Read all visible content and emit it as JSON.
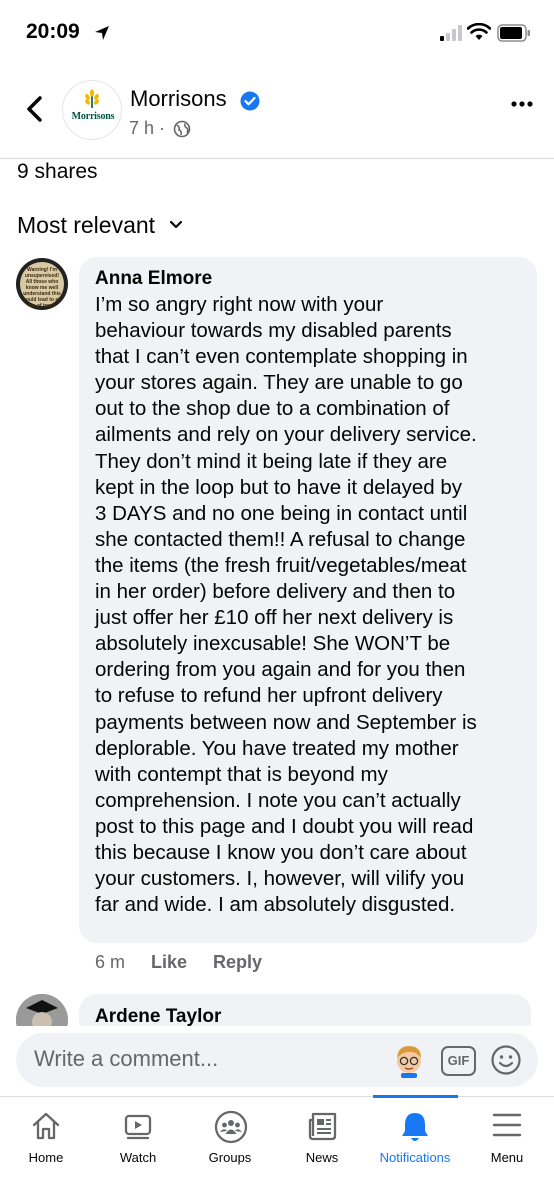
{
  "status_bar": {
    "time": "20:09"
  },
  "header": {
    "page_name": "Morrisons",
    "post_time": "7 h ·",
    "logo_text": "Morrisons"
  },
  "post": {
    "shares": "9 shares"
  },
  "sort": {
    "label": "Most relevant"
  },
  "comments": [
    {
      "author": "Anna Elmore",
      "avatar_text": "Warning! I'm unsupervised! All those who know me well understand this could lead to all kinds of trouble!",
      "lines": [
        "I’m so angry right now with your",
        "behaviour towards my disabled parents",
        "that I can’t even contemplate shopping in",
        "your stores again. They are unable to go",
        "out to the shop due to a combination of",
        "ailments and rely on your delivery service.",
        "They don’t mind it being late if they are",
        "kept in the loop but to have it delayed by",
        "3 DAYS and no one being in contact until",
        "she contacted them!! A refusal to change",
        "the items (the fresh fruit/vegetables/meat",
        "in her order) before delivery and then to",
        "just offer her £10 off her next delivery is",
        "absolutely inexcusable! She WON’T be",
        "ordering from you again and for you then",
        "to refuse to refund her upfront delivery",
        "payments between now and September is",
        "deplorable. You have treated my mother",
        "with contempt that is beyond my",
        "comprehension. I note you can’t actually",
        "post to this page and I doubt you will read",
        "this because I know you don’t care about",
        "your customers. I, however, will vilify you",
        "far and wide. I am absolutely disgusted."
      ],
      "time": "6 m",
      "like_label": "Like",
      "reply_label": "Reply"
    },
    {
      "author": "Ardene Taylor"
    }
  ],
  "composer": {
    "placeholder": "Write a comment...",
    "gif_label": "GIF"
  },
  "tabs": [
    {
      "label": "Home",
      "icon": "home-icon"
    },
    {
      "label": "Watch",
      "icon": "watch-icon"
    },
    {
      "label": "Groups",
      "icon": "groups-icon"
    },
    {
      "label": "News",
      "icon": "news-icon"
    },
    {
      "label": "Notifications",
      "icon": "bell-icon",
      "active": true
    },
    {
      "label": "Menu",
      "icon": "menu-icon"
    }
  ],
  "colors": {
    "accent": "#1877f2",
    "bubble": "#f0f2f5",
    "secondary_text": "#65676b",
    "brand_green": "#00563f",
    "brand_yellow": "#f5b800"
  }
}
